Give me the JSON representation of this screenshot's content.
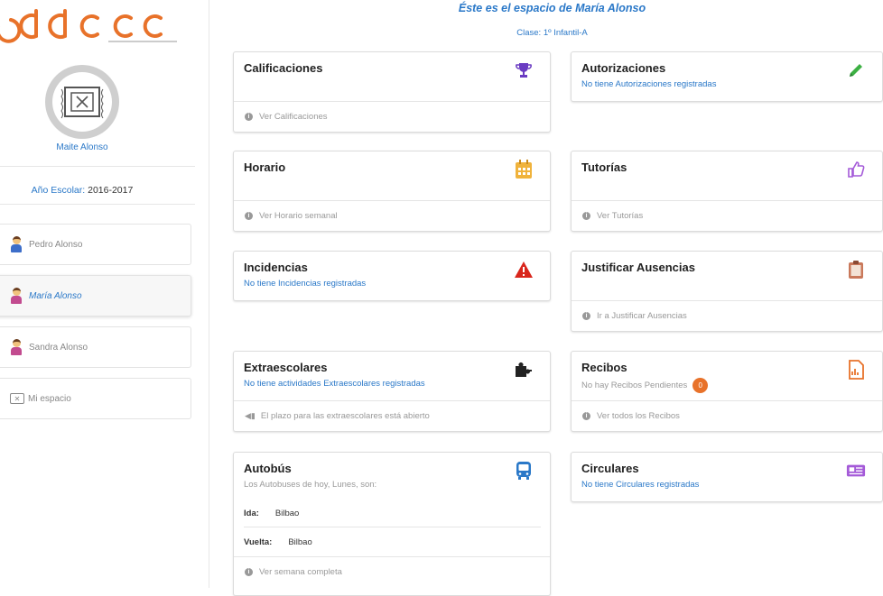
{
  "sidebar": {
    "user_name": "Maite Alonso",
    "year_label": "Año Escolar:",
    "year_value": "2016-2017",
    "children": [
      {
        "label": "Pedro Alonso",
        "color": "#3d6ec9"
      },
      {
        "label": "María Alonso",
        "color": "#c24b8f"
      },
      {
        "label": "Sandra Alonso",
        "color": "#c24b8f"
      }
    ],
    "my_space": "Mi espacio",
    "brand_color": "#e8722a"
  },
  "header": {
    "title": "Éste es el espacio de María Alonso",
    "class_label": "Clase: 1º Infantil-A"
  },
  "cards": {
    "calificaciones": {
      "title": "Calificaciones",
      "footer": "Ver Calificaciones",
      "icon": "trophy-icon",
      "icon_color": "#6a3bc2"
    },
    "autorizaciones": {
      "title": "Autorizaciones",
      "subtitle": "No tiene Autorizaciones registradas",
      "icon": "pencil-icon",
      "icon_color": "#3cb043"
    },
    "horario": {
      "title": "Horario",
      "footer": "Ver Horario semanal",
      "icon": "calendar-icon",
      "icon_color": "#f0b33c"
    },
    "tutorias": {
      "title": "Tutorías",
      "footer": "Ver Tutorías",
      "icon": "thumbs-up-icon",
      "icon_color": "#a45ad8"
    },
    "incidencias": {
      "title": "Incidencias",
      "subtitle": "No tiene Incidencias registradas",
      "icon": "warning-icon",
      "icon_color": "#d9261c"
    },
    "justificar": {
      "title": "Justificar Ausencias",
      "footer": "Ir a Justificar Ausencias",
      "icon": "clipboard-icon",
      "icon_color": "#c9785a"
    },
    "extraescolares": {
      "title": "Extraescolares",
      "subtitle": "No tiene actividades Extraescolares registradas",
      "footer": "El plazo para las extraescolares está abierto",
      "icon": "puzzle-icon",
      "icon_color": "#222222"
    },
    "recibos": {
      "title": "Recibos",
      "subtitle": "No hay Recibos Pendientes",
      "badge": "0",
      "footer": "Ver todos los Recibos",
      "icon": "receipt-icon",
      "icon_color": "#e8722a"
    },
    "autobus": {
      "title": "Autobús",
      "subtitle": "Los Autobuses de hoy, Lunes, son:",
      "ida_label": "Ida:",
      "ida_value": "Bilbao",
      "vuelta_label": "Vuelta:",
      "vuelta_value": "Bilbao",
      "footer": "Ver semana completa",
      "icon": "bus-icon",
      "icon_color": "#2a78c8"
    },
    "circulares": {
      "title": "Circulares",
      "subtitle": "No tiene Circulares registradas",
      "icon": "newspaper-icon",
      "icon_color": "#a45ad8"
    }
  }
}
